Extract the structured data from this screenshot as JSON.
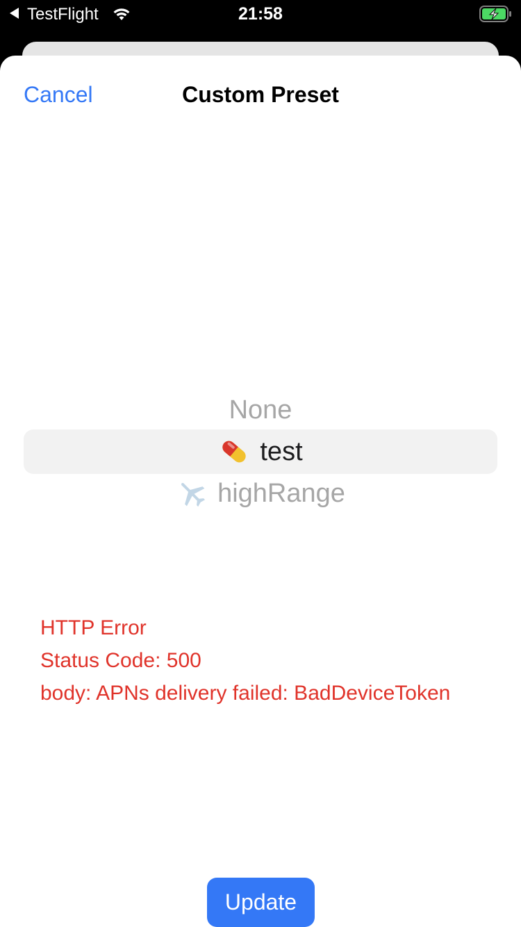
{
  "status_bar": {
    "back_app": "TestFlight",
    "time": "21:58",
    "icons": [
      "back-arrow-icon",
      "wifi-icon",
      "battery-charging-icon"
    ],
    "battery_color": "#4cd964"
  },
  "nav": {
    "cancel_label": "Cancel",
    "title": "Custom Preset"
  },
  "picker": {
    "options": [
      {
        "icon": "",
        "label": "None"
      },
      {
        "icon": "pill-icon",
        "label": "test"
      },
      {
        "icon": "airplane-icon",
        "label": "highRange"
      }
    ],
    "selected_label": "test"
  },
  "error": {
    "lines": [
      "HTTP Error",
      "Status Code: 500",
      "body: APNs delivery failed: BadDeviceToken"
    ],
    "color": "#e0332a"
  },
  "actions": {
    "update_label": "Update"
  },
  "colors": {
    "accent": "#3478f6",
    "error": "#e0332a"
  }
}
